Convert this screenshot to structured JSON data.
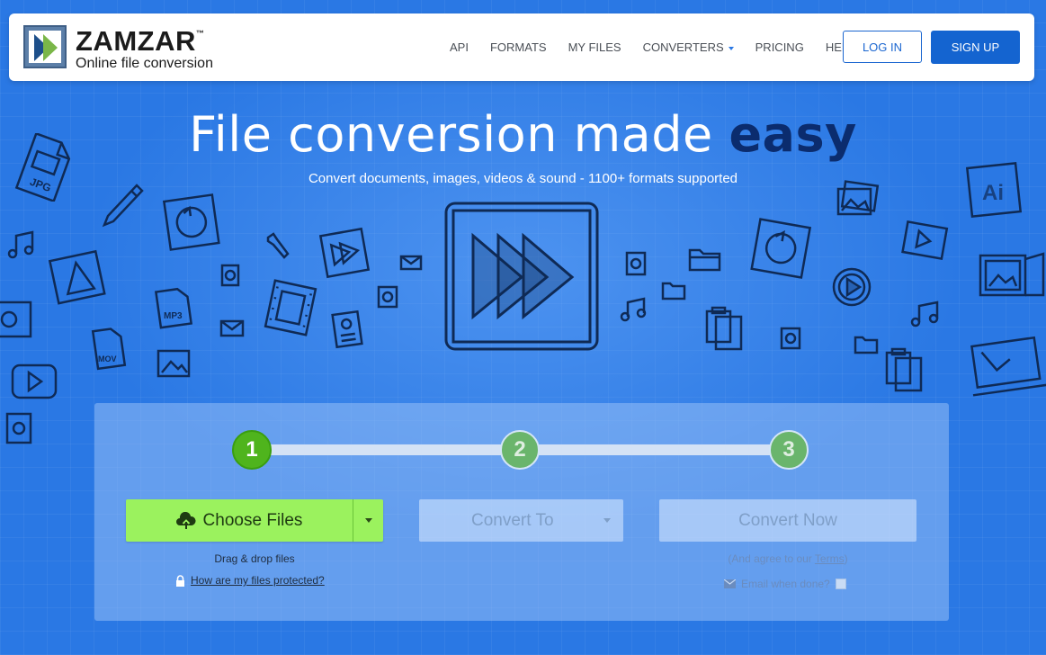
{
  "brand": {
    "name": "ZAMZAR",
    "trademark": "™",
    "tagline": "Online file conversion"
  },
  "nav": {
    "items": [
      {
        "label": "API"
      },
      {
        "label": "FORMATS"
      },
      {
        "label": "MY FILES"
      },
      {
        "label": "CONVERTERS"
      },
      {
        "label": "PRICING"
      },
      {
        "label": "HELP"
      }
    ],
    "login_label": "LOG IN",
    "signup_label": "SIGN UP"
  },
  "hero": {
    "title_main": "File conversion made ",
    "title_emphasis": "easy",
    "subtitle": "Convert documents, images, videos & sound - 1100+ formats supported"
  },
  "steps": [
    "1",
    "2",
    "3"
  ],
  "converter": {
    "choose_files_label": "Choose Files",
    "drag_drop_text": "Drag & drop files",
    "protection_link": "How are my files protected?",
    "convert_to_label": "Convert To",
    "convert_now_label": "Convert Now",
    "agree_prefix": "(And agree to our ",
    "terms_link": "Terms",
    "agree_suffix": ")",
    "email_label": "Email when done?"
  },
  "doodle_labels": {
    "jpg": "JPG",
    "mp3": "MP3",
    "mov": "MOV",
    "ai": "Ai"
  },
  "colors": {
    "background": "#2a78e4",
    "choose_files": "#9bf25e",
    "step_active": "#4fb41d",
    "signup": "#1464d0",
    "title_emphasis": "#0b2c6e"
  }
}
